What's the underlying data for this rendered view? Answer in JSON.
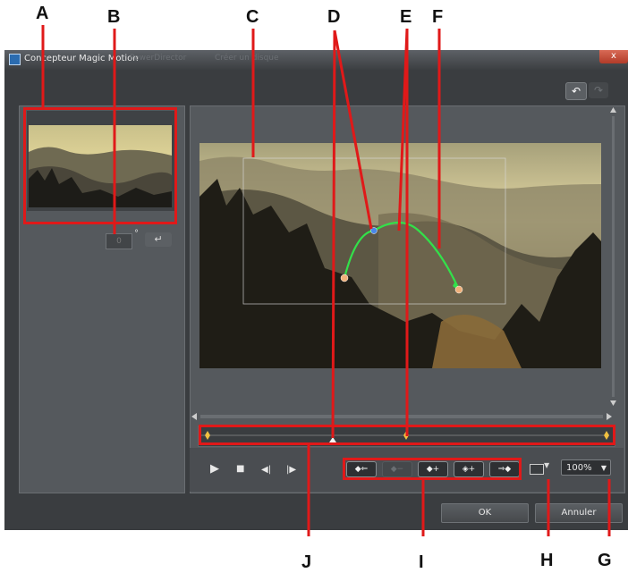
{
  "window": {
    "title": "Concepteur Magic Motion",
    "ghost_titles": [
      "PowerDirector",
      "Créer un disque"
    ],
    "close_label": "x"
  },
  "toolbar": {
    "undo_label": "↶",
    "redo_label": "↷"
  },
  "rotation": {
    "value": "0",
    "degree_symbol": "°",
    "apply_label": "↵"
  },
  "playback": {
    "play": "▶",
    "stop": "■",
    "prev_frame": "◀|",
    "next_frame": "|▶"
  },
  "keyframes": [
    {
      "label": "◆⇐",
      "enabled": true
    },
    {
      "label": "◆−",
      "enabled": false
    },
    {
      "label": "◆+",
      "enabled": true
    },
    {
      "label": "◈+",
      "enabled": true
    },
    {
      "label": "⇒◆",
      "enabled": true
    }
  ],
  "zoom": {
    "value": "100%",
    "arrow": "▼"
  },
  "aspect_arrow": "▼",
  "dialog_buttons": {
    "ok": "OK",
    "cancel": "Annuler"
  },
  "callouts": [
    "A",
    "B",
    "C",
    "D",
    "E",
    "F",
    "G",
    "H",
    "I",
    "J"
  ],
  "colors": {
    "highlight_red": "#e01919",
    "motion_path": "#33e04a",
    "keyframe": "#f0c040"
  }
}
